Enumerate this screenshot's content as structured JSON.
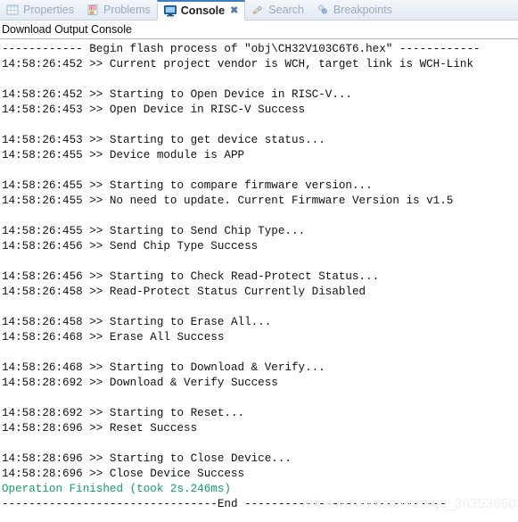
{
  "tabs": [
    {
      "id": "properties",
      "label": "Properties",
      "icon": "properties-table-icon",
      "active": false,
      "closable": false
    },
    {
      "id": "problems",
      "label": "Problems",
      "icon": "problems-warning-icon",
      "active": false,
      "closable": false
    },
    {
      "id": "console",
      "label": "Console",
      "icon": "console-monitor-icon",
      "active": true,
      "closable": true,
      "close_glyph": "✖"
    },
    {
      "id": "search",
      "label": "Search",
      "icon": "search-pencil-icon",
      "active": false,
      "closable": false
    },
    {
      "id": "breakpoints",
      "label": "Breakpoints",
      "icon": "breakpoints-dots-icon",
      "active": false,
      "closable": false
    }
  ],
  "console": {
    "title": "Download Output Console",
    "lines": [
      {
        "text": "------------ Begin flash process of \"obj\\CH32V103C6T6.hex\" ------------",
        "style": "normal"
      },
      {
        "text": "14:58:26:452 >> Current project vendor is WCH, target link is WCH-Link",
        "style": "normal"
      },
      {
        "text": "",
        "style": "blank"
      },
      {
        "text": "14:58:26:452 >> Starting to Open Device in RISC-V...",
        "style": "normal"
      },
      {
        "text": "14:58:26:453 >> Open Device in RISC-V Success",
        "style": "normal"
      },
      {
        "text": "",
        "style": "blank"
      },
      {
        "text": "14:58:26:453 >> Starting to get device status...",
        "style": "normal"
      },
      {
        "text": "14:58:26:455 >> Device module is APP",
        "style": "normal"
      },
      {
        "text": "",
        "style": "blank"
      },
      {
        "text": "14:58:26:455 >> Starting to compare firmware version...",
        "style": "normal"
      },
      {
        "text": "14:58:26:455 >> No need to update. Current Firmware Version is v1.5",
        "style": "normal"
      },
      {
        "text": "",
        "style": "blank"
      },
      {
        "text": "14:58:26:455 >> Starting to Send Chip Type...",
        "style": "normal"
      },
      {
        "text": "14:58:26:456 >> Send Chip Type Success",
        "style": "normal"
      },
      {
        "text": "",
        "style": "blank"
      },
      {
        "text": "14:58:26:456 >> Starting to Check Read-Protect Status...",
        "style": "normal"
      },
      {
        "text": "14:58:26:458 >> Read-Protect Status Currently Disabled",
        "style": "normal"
      },
      {
        "text": "",
        "style": "blank"
      },
      {
        "text": "14:58:26:458 >> Starting to Erase All...",
        "style": "normal"
      },
      {
        "text": "14:58:26:468 >> Erase All Success",
        "style": "normal"
      },
      {
        "text": "",
        "style": "blank"
      },
      {
        "text": "14:58:26:468 >> Starting to Download & Verify...",
        "style": "normal"
      },
      {
        "text": "14:58:28:692 >> Download & Verify Success",
        "style": "normal"
      },
      {
        "text": "",
        "style": "blank"
      },
      {
        "text": "14:58:28:692 >> Starting to Reset...",
        "style": "normal"
      },
      {
        "text": "14:58:28:696 >> Reset Success",
        "style": "normal"
      },
      {
        "text": "",
        "style": "blank"
      },
      {
        "text": "14:58:28:696 >> Starting to Close Device...",
        "style": "normal"
      },
      {
        "text": "14:58:28:696 >> Close Device Success",
        "style": "normal"
      },
      {
        "text": "Operation Finished (took 2s.246ms)",
        "style": "success"
      },
      {
        "text": "--------------------------------End ------------------------------",
        "style": "normal"
      }
    ]
  },
  "watermark": {
    "text": "https://blog.csdn.net/qq_36353650"
  },
  "colors": {
    "success_green": "#11a06a",
    "tab_inactive_text": "#9aabc0",
    "tab_active_text": "#1d1d1d",
    "console_text": "#101010",
    "active_tab_underline": "#3f7fbf"
  }
}
